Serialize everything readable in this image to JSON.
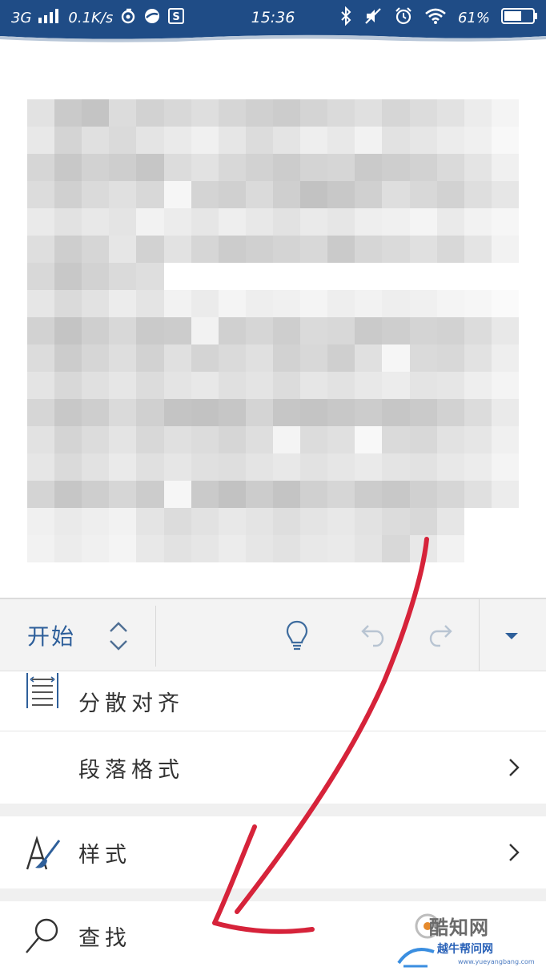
{
  "status_bar": {
    "network": "3G",
    "speed": "0.1K/s",
    "time": "15:36",
    "battery": "61%",
    "icons": [
      "signal-icon",
      "netease-icon",
      "app-icon",
      "s-badge-icon",
      "bluetooth-icon",
      "mute-icon",
      "alarm-icon",
      "wifi-icon",
      "battery-icon"
    ]
  },
  "document": {
    "content_state": "blurred/pixelated",
    "pixel_shades": [
      "#e2e2e2",
      "#cacaca",
      "#c4c4c4",
      "#dcdcdc",
      "#d2d2d2",
      "#d8d8d8",
      "#dedede",
      "#d6d6d6",
      "#d0d0d0",
      "#cccccc",
      "#d4d4d4",
      "#dadada",
      "#e0e0e0",
      "#d6d6d6",
      "#dcdcdc",
      "#e2e2e2",
      "#ececec",
      "#f4f4f4",
      "#e8e8e8",
      "#d4d4d4",
      "#e0e0e0",
      "#dadada",
      "#e4e4e4",
      "#eaeaea",
      "#f0f0f0",
      "#e6e6e6",
      "#dcdcdc",
      "#e4e4e4",
      "#eeeeee",
      "#e8e8e8",
      "#f2f2f2",
      "#e2e2e2",
      "#e6e6e6",
      "#ececec",
      "#f0f0f0",
      "#f8f8f8",
      "#d6d6d6",
      "#c8c8c8",
      "#d2d2d2",
      "#cecece",
      "#c6c6c6",
      "#dcdcdc",
      "#e2e2e2",
      "#d8d8d8",
      "#d2d2d2",
      "#cccccc",
      "#d4d4d4",
      "#d6d6d6",
      "#cacaca",
      "#cecece",
      "#d2d2d2",
      "#dadada",
      "#e4e4e4",
      "#f0f0f0",
      "#dcdcdc",
      "#d0d0d0",
      "#dadada",
      "#e0e0e0",
      "#d8d8d8",
      "#f6f6f6",
      "#d4d4d4",
      "#d0d0d0",
      "#dadada",
      "#cfcfcf",
      "#c2c2c2",
      "#c8c8c8",
      "#d0d0d0",
      "#dedede",
      "#d8d8d8",
      "#d2d2d2",
      "#dedede",
      "#e6e6e6",
      "#eaeaea",
      "#e2e2e2",
      "#e8e8e8",
      "#e4e4e4",
      "#f2f2f2",
      "#ececec",
      "#e6e6e6",
      "#eeeeee",
      "#e8e8e8",
      "#e2e2e2",
      "#eaeaea",
      "#e6e6e6",
      "#eeeeee",
      "#f0f0f0",
      "#f4f4f4",
      "#eaeaea",
      "#f2f2f2",
      "#f6f6f6",
      "#dedede",
      "#cecece",
      "#d6d6d6",
      "#e6e6e6",
      "#d2d2d2",
      "#e2e2e2",
      "#d6d6d6",
      "#cccccc",
      "#d0d0d0",
      "#d4d4d4",
      "#d8d8d8",
      "#cacaca",
      "#d6d6d6",
      "#dadada",
      "#e0e0e0",
      "#d8d8d8",
      "#e4e4e4",
      "#f2f2f2",
      "#d8d8d8",
      "#c8c8c8",
      "#d2d2d2",
      "#dadada",
      "#dedede",
      "#ffffff",
      "#ffffff",
      "#ffffff",
      "#ffffff",
      "#ffffff",
      "#ffffff",
      "#ffffff",
      "#ffffff",
      "#ffffff",
      "#ffffff",
      "#ffffff",
      "#ffffff",
      "#ffffff",
      "#e6e6e6",
      "#dadada",
      "#e2e2e2",
      "#ececec",
      "#e4e4e4",
      "#f2f2f2",
      "#ebebeb",
      "#f4f4f4",
      "#eeeeee",
      "#f0f0f0",
      "#f4f4f4",
      "#eeeeee",
      "#f2f2f2",
      "#eeeeee",
      "#f0f0f0",
      "#f4f4f4",
      "#f6f6f6",
      "#fafafa",
      "#d2d2d2",
      "#c4c4c4",
      "#cfcfcf",
      "#d8d8d8",
      "#cacaca",
      "#cccccc",
      "#f2f2f2",
      "#d0d0d0",
      "#d6d6d6",
      "#cecece",
      "#dadada",
      "#d8d8d8",
      "#cacaca",
      "#cecece",
      "#d4d4d4",
      "#d2d2d2",
      "#dcdcdc",
      "#e8e8e8",
      "#dcdcdc",
      "#cccccc",
      "#d6d6d6",
      "#dedede",
      "#d2d2d2",
      "#e0e0e0",
      "#d4d4d4",
      "#dadada",
      "#e0e0e0",
      "#d2d2d2",
      "#d8d8d8",
      "#cfcfcf",
      "#e0e0e0",
      "#f6f6f6",
      "#dadada",
      "#d8d8d8",
      "#e2e2e2",
      "#eeeeee",
      "#e4e4e4",
      "#d8d8d8",
      "#e0e0e0",
      "#e6e6e6",
      "#dcdcdc",
      "#e4e4e4",
      "#e8e8e8",
      "#e0e0e0",
      "#e4e4e4",
      "#dcdcdc",
      "#e6e6e6",
      "#e2e2e2",
      "#e8e8e8",
      "#ececec",
      "#e4e4e4",
      "#e6e6e6",
      "#eeeeee",
      "#f4f4f4",
      "#d6d6d6",
      "#c8c8c8",
      "#cecece",
      "#dadada",
      "#d0d0d0",
      "#c4c4c4",
      "#c2c2c2",
      "#c6c6c6",
      "#d4d4d4",
      "#c6c6c6",
      "#c4c4c4",
      "#c8c8c8",
      "#cccccc",
      "#c6c6c6",
      "#cacaca",
      "#d2d2d2",
      "#dcdcdc",
      "#eaeaea",
      "#e2e2e2",
      "#d4d4d4",
      "#dcdcdc",
      "#e4e4e4",
      "#d8d8d8",
      "#e0e0e0",
      "#dcdcdc",
      "#d6d6d6",
      "#dedede",
      "#f4f4f4",
      "#dcdcdc",
      "#e0e0e0",
      "#f8f8f8",
      "#dadada",
      "#d8d8d8",
      "#e2e2e2",
      "#e6e6e6",
      "#f0f0f0",
      "#e6e6e6",
      "#dadada",
      "#e2e2e2",
      "#eaeaea",
      "#e0e0e0",
      "#e6e6e6",
      "#e0e0e0",
      "#dedede",
      "#e4e4e4",
      "#e8e8e8",
      "#e2e2e2",
      "#e6e6e6",
      "#eaeaea",
      "#e4e4e4",
      "#e2e2e2",
      "#e8e8e8",
      "#ececec",
      "#f4f4f4",
      "#d4d4d4",
      "#c6c6c6",
      "#cecece",
      "#d6d6d6",
      "#cccccc",
      "#f6f6f6",
      "#cacaca",
      "#c2c2c2",
      "#cccccc",
      "#c4c4c4",
      "#d0d0d0",
      "#d6d6d6",
      "#cccccc",
      "#c8c8c8",
      "#d0d0d0",
      "#d6d6d6",
      "#e0e0e0",
      "#ececec",
      "#f0f0f0",
      "#eaeaea",
      "#eeeeee",
      "#f2f2f2",
      "#e4e4e4",
      "#dcdcdc",
      "#e2e2e2",
      "#e8e8e8",
      "#e4e4e4",
      "#dedede",
      "#e4e4e4",
      "#e8e8e8",
      "#e2e2e2",
      "#dcdcdc",
      "#d8d8d8",
      "#e6e6e6",
      "#ffffff",
      "#ffffff",
      "#f2f2f2",
      "#ececec",
      "#f0f0f0",
      "#f4f4f4",
      "#e8e8e8",
      "#e2e2e2",
      "#e6e6e6",
      "#ececec",
      "#e6e6e6",
      "#e2e2e2",
      "#e8e8e8",
      "#eaeaea",
      "#e4e4e4",
      "#d8d8d8",
      "#e8e8e8",
      "#f2f2f2",
      "#ffffff",
      "#ffffff"
    ]
  },
  "toolbar": {
    "tab_label": "开始",
    "icons": [
      "tab-switch-icon",
      "lightbulb-icon",
      "undo-icon",
      "redo-icon",
      "collapse-icon"
    ]
  },
  "menu": {
    "items": [
      {
        "label": "分散对齐",
        "icon": "distributed-align-icon",
        "has_chevron": false
      },
      {
        "label": "段落格式",
        "icon": null,
        "has_chevron": true
      },
      {
        "label": "样式",
        "icon": "styles-brush-icon",
        "has_chevron": true
      },
      {
        "label": "查找",
        "icon": "search-icon",
        "has_chevron": false
      }
    ]
  },
  "watermark": {
    "logo_text": "酷知网",
    "sub_text": "越牛帮问网",
    "url": "www.yueyangbang.com"
  },
  "colors": {
    "status_bar": "#1f4c86",
    "accent_blue": "#2e5f9a",
    "annotation_red": "#d6233a",
    "toolbar_bg": "#f3f3f3"
  }
}
